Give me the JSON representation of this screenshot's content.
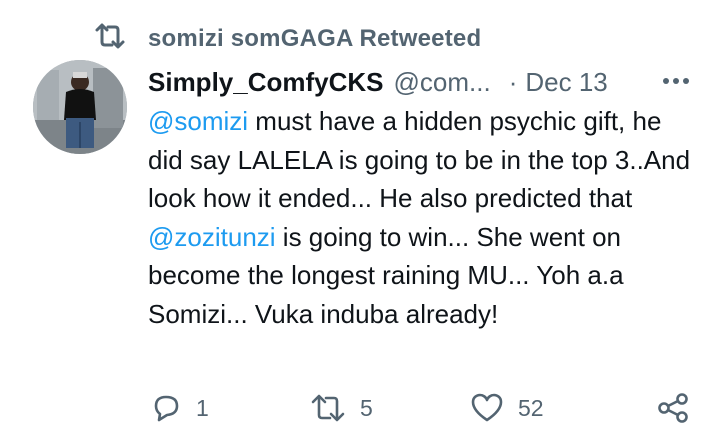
{
  "retweet_banner": {
    "text": "somizi somGAGA Retweeted"
  },
  "tweet": {
    "display_name": "Simply_ComfyCKS",
    "handle": "@com...",
    "separator": "·",
    "date": "Dec 13",
    "body": {
      "mention1": "@somizi",
      "text1": " must have a hidden psychic gift, he did say LALELA is going to be in the top 3..And look how it ended... He also predicted that ",
      "mention2": "@zozitunzi",
      "text2": " is going to win... She went on become the longest raining MU... Yoh a.a Somizi... Vuka induba already!"
    }
  },
  "actions": {
    "reply_count": "1",
    "retweet_count": "5",
    "like_count": "52"
  },
  "colors": {
    "text_primary": "#0f1419",
    "text_secondary": "#536471",
    "mention": "#1d9bf0"
  },
  "icons": [
    "retweet-icon",
    "more-options-icon",
    "reply-icon",
    "retweet-icon",
    "like-icon",
    "share-icon"
  ]
}
